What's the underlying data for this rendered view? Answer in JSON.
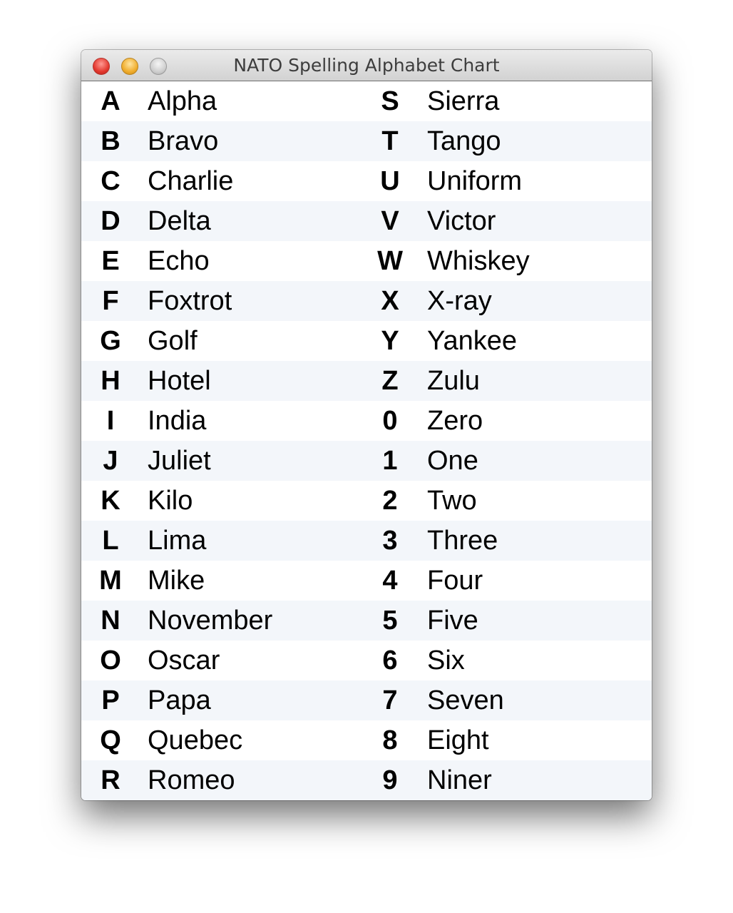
{
  "window": {
    "title": "NATO Spelling Alphabet Chart",
    "buttons": [
      "close",
      "minimize",
      "zoom"
    ]
  },
  "colors": {
    "row_alt": "#f3f6fa",
    "row": "#ffffff",
    "close": "#e3382e",
    "minimize": "#f0ad2d",
    "zoom": "#cfcfcf"
  },
  "rows": [
    {
      "left": {
        "letter": "A",
        "word": "Alpha"
      },
      "right": {
        "letter": "S",
        "word": "Sierra"
      }
    },
    {
      "left": {
        "letter": "B",
        "word": "Bravo"
      },
      "right": {
        "letter": "T",
        "word": "Tango"
      }
    },
    {
      "left": {
        "letter": "C",
        "word": "Charlie"
      },
      "right": {
        "letter": "U",
        "word": "Uniform"
      }
    },
    {
      "left": {
        "letter": "D",
        "word": "Delta"
      },
      "right": {
        "letter": "V",
        "word": "Victor"
      }
    },
    {
      "left": {
        "letter": "E",
        "word": "Echo"
      },
      "right": {
        "letter": "W",
        "word": "Whiskey"
      }
    },
    {
      "left": {
        "letter": "F",
        "word": "Foxtrot"
      },
      "right": {
        "letter": "X",
        "word": "X-ray"
      }
    },
    {
      "left": {
        "letter": "G",
        "word": "Golf"
      },
      "right": {
        "letter": "Y",
        "word": "Yankee"
      }
    },
    {
      "left": {
        "letter": "H",
        "word": "Hotel"
      },
      "right": {
        "letter": "Z",
        "word": "Zulu"
      }
    },
    {
      "left": {
        "letter": "I",
        "word": "India"
      },
      "right": {
        "letter": "0",
        "word": "Zero"
      }
    },
    {
      "left": {
        "letter": "J",
        "word": "Juliet"
      },
      "right": {
        "letter": "1",
        "word": "One"
      }
    },
    {
      "left": {
        "letter": "K",
        "word": "Kilo"
      },
      "right": {
        "letter": "2",
        "word": "Two"
      }
    },
    {
      "left": {
        "letter": "L",
        "word": "Lima"
      },
      "right": {
        "letter": "3",
        "word": "Three"
      }
    },
    {
      "left": {
        "letter": "M",
        "word": "Mike"
      },
      "right": {
        "letter": "4",
        "word": "Four"
      }
    },
    {
      "left": {
        "letter": "N",
        "word": "November"
      },
      "right": {
        "letter": "5",
        "word": "Five"
      }
    },
    {
      "left": {
        "letter": "O",
        "word": "Oscar"
      },
      "right": {
        "letter": "6",
        "word": "Six"
      }
    },
    {
      "left": {
        "letter": "P",
        "word": "Papa"
      },
      "right": {
        "letter": "7",
        "word": "Seven"
      }
    },
    {
      "left": {
        "letter": "Q",
        "word": "Quebec"
      },
      "right": {
        "letter": "8",
        "word": "Eight"
      }
    },
    {
      "left": {
        "letter": "R",
        "word": "Romeo"
      },
      "right": {
        "letter": "9",
        "word": "Niner"
      }
    }
  ]
}
